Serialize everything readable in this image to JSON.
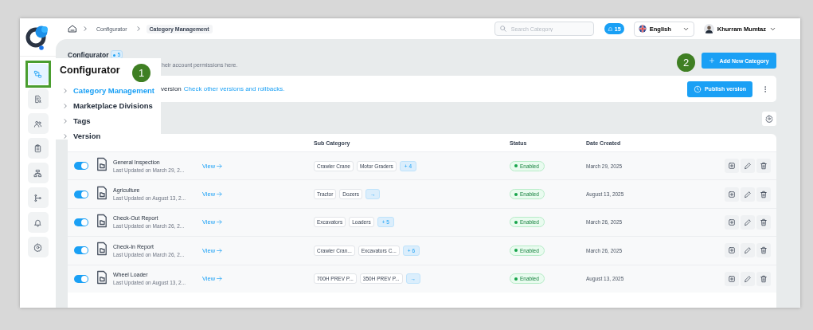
{
  "breadcrumb": [
    {
      "label": "Configurator",
      "current": false
    },
    {
      "label": "Category Management",
      "current": true
    }
  ],
  "header": {
    "search_placeholder": "Search Category",
    "notifications": "15",
    "language": "English",
    "user": "Khurram Mumtaz"
  },
  "sidebar": {
    "items": [
      {
        "selected": true
      },
      {
        "selected": false
      },
      {
        "selected": false
      },
      {
        "selected": false
      },
      {
        "selected": false
      },
      {
        "selected": false
      },
      {
        "selected": false
      },
      {
        "selected": false
      }
    ]
  },
  "flyout": {
    "title": "Configurator",
    "items": [
      {
        "label": "Category Management",
        "selected": true
      },
      {
        "label": "Marketplace Divisions",
        "selected": false
      },
      {
        "label": "Tags",
        "selected": false
      },
      {
        "label": "Version",
        "selected": false
      }
    ]
  },
  "page": {
    "title": "Configurator",
    "count": "5",
    "subtitle": "heir account permissions here.",
    "add_button": "Add New Category"
  },
  "version_bar": {
    "text": "version",
    "link": "Check other versions and rollbacks.",
    "publish_button": "Publish version"
  },
  "table": {
    "columns": [
      "Sub Category",
      "Status",
      "Date Created"
    ],
    "rows": [
      {
        "on": true,
        "name": "General Inspection",
        "updated": "Last Updated on March 29, 2...",
        "view": "View",
        "tags": [
          {
            "text": "Crawler Crane",
            "kind": "tag"
          },
          {
            "text": "Motor Graders",
            "kind": "tag"
          },
          {
            "text": "+ 4",
            "kind": "more"
          }
        ],
        "status": "Enabled",
        "date": "March 29, 2025"
      },
      {
        "on": true,
        "name": "Agriculture",
        "updated": "Last Updated on August 13, 2...",
        "view": "View",
        "tags": [
          {
            "text": "Tractor",
            "kind": "tag"
          },
          {
            "text": "Dozers",
            "kind": "tag"
          },
          {
            "text": "→",
            "kind": "more"
          }
        ],
        "status": "Enabled",
        "date": "August 13, 2025"
      },
      {
        "on": true,
        "name": "Check-Out Report",
        "updated": "Last Updated on March 26, 2...",
        "view": "View",
        "tags": [
          {
            "text": "Excavators",
            "kind": "tag"
          },
          {
            "text": "Loaders",
            "kind": "tag"
          },
          {
            "text": "+ 5",
            "kind": "more"
          }
        ],
        "status": "Enabled",
        "date": "March 26, 2025"
      },
      {
        "on": true,
        "name": "Check-In Report",
        "updated": "Last Updated on March 26, 2...",
        "view": "View",
        "tags": [
          {
            "text": "Crawler Cran...",
            "kind": "tag"
          },
          {
            "text": "Excavators C...",
            "kind": "tag"
          },
          {
            "text": "+ 6",
            "kind": "more"
          }
        ],
        "status": "Enabled",
        "date": "March 26, 2025"
      },
      {
        "on": true,
        "name": "Wheel Loader",
        "updated": "Last Updated on August 13, 2...",
        "view": "View",
        "tags": [
          {
            "text": "700H PREV P...",
            "kind": "tag"
          },
          {
            "text": "350H PREV P...",
            "kind": "tag"
          },
          {
            "text": "→",
            "kind": "more"
          }
        ],
        "status": "Enabled",
        "date": "August 13, 2025"
      }
    ]
  },
  "annotations": [
    {
      "label": "1"
    },
    {
      "label": "2"
    }
  ]
}
